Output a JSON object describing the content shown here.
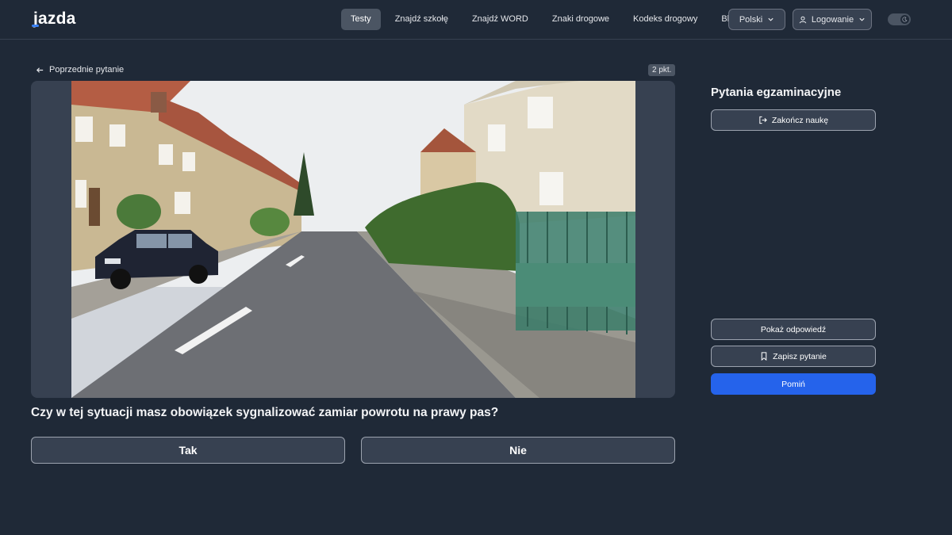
{
  "header": {
    "logo": "jazda",
    "nav": [
      {
        "label": "Testy",
        "active": true
      },
      {
        "label": "Znajdź szkołę",
        "active": false
      },
      {
        "label": "Znajdź WORD",
        "active": false
      },
      {
        "label": "Znaki drogowe",
        "active": false
      },
      {
        "label": "Kodeks drogowy",
        "active": false
      },
      {
        "label": "Blog",
        "active": false
      }
    ],
    "language": "Polski",
    "login": "Logowanie",
    "theme_toggle_icon": "moon-icon"
  },
  "question": {
    "back_label": "Poprzednie pytanie",
    "points": "2 pkt.",
    "text": "Czy w tej sytuacji masz obowiązek sygnalizować zamiar powrotu na prawy pas?",
    "answers": [
      "Tak",
      "Nie"
    ]
  },
  "sidebar": {
    "title": "Pytania egzaminacyjne",
    "finish_label": "Zakończ naukę",
    "show_answer_label": "Pokaż odpowiedź",
    "save_label": "Zapisz pytanie",
    "skip_label": "Pomiń"
  },
  "colors": {
    "background": "#1f2937",
    "accent": "#2563eb",
    "logo_accent": "#3b82f6"
  }
}
